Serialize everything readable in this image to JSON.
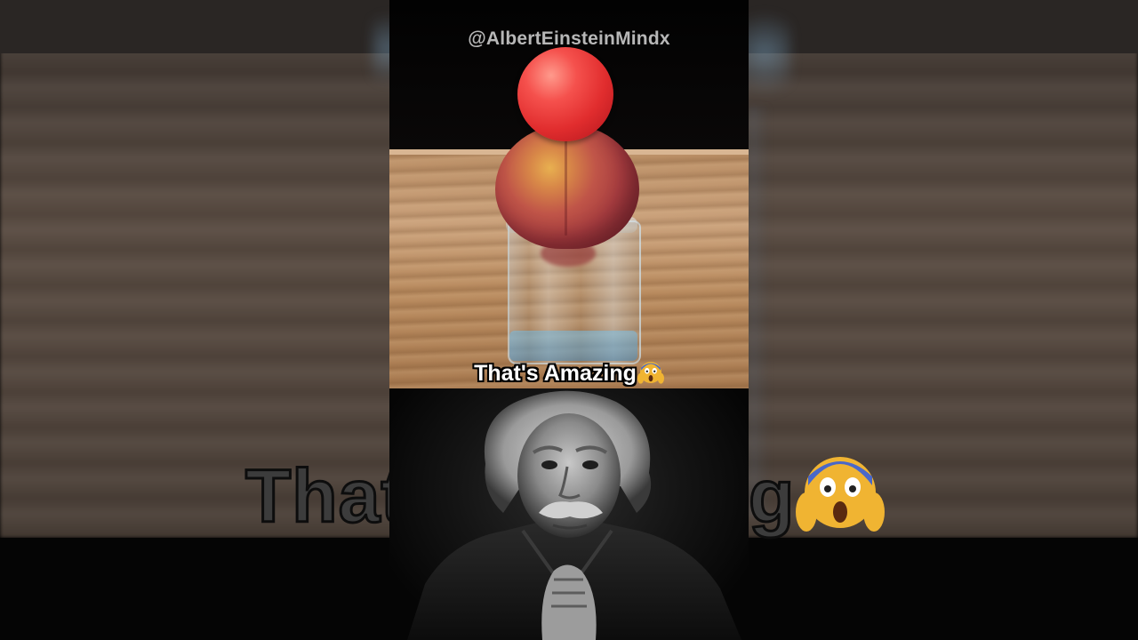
{
  "video": {
    "watermark": "@AlbertEinsteinMindx",
    "caption": "That's Amazing",
    "caption_emoji": "face-screaming-in-fear"
  },
  "background": {
    "caption_left": "That",
    "caption_right": "g"
  },
  "colors": {
    "ball": "#e12d2e",
    "peach": "#c05548",
    "table": "#b98d64",
    "caption_text": "#ffffff"
  }
}
